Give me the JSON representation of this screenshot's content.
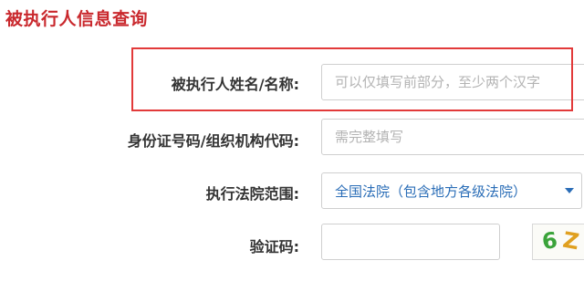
{
  "page_title": "被执行人信息查询",
  "form": {
    "name_label": "被执行人姓名/名称:",
    "name_placeholder": "可以仅填写前部分，至少两个汉字",
    "id_label": "身份证号码/组织机构代码:",
    "id_placeholder": "需完整填写",
    "court_label": "执行法院范围:",
    "court_selected": "全国法院（包含地方各级法院）",
    "captcha_label": "验证码:",
    "captcha_value": "",
    "captcha_image_text": [
      "6",
      "Z"
    ]
  },
  "colors": {
    "title": "#c9282d",
    "highlight_border": "#e23a3a",
    "select_text": "#2a6db7",
    "captcha_char_1": "#3aa33a",
    "captcha_char_2": "#e0a020"
  }
}
